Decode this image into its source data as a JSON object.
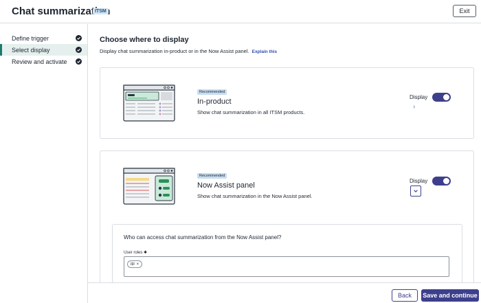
{
  "header": {
    "title": "Chat summarization",
    "badge": "ITSM",
    "exit_label": "Exit"
  },
  "sidebar": {
    "steps": [
      {
        "label": "Define trigger",
        "completed": true,
        "active": false
      },
      {
        "label": "Select display",
        "completed": true,
        "active": true
      },
      {
        "label": "Review and activate",
        "completed": true,
        "active": false
      }
    ]
  },
  "main": {
    "title": "Choose where to display",
    "subtitle": "Display chat summarization in-product or in the Now Assist panel.",
    "explain_link": "Explain this",
    "options": [
      {
        "badge": "Recommended",
        "title": "In-product",
        "description": "Show chat summarization in all ITSM products.",
        "toggle_label": "Display",
        "toggle_on": true,
        "expand_icon": "chevron-right-icon"
      },
      {
        "badge": "Recommended",
        "title": "Now Assist panel",
        "description": "Show chat summarization in the Now Assist panel.",
        "toggle_label": "Display",
        "toggle_on": true,
        "expand_icon": "chevron-down-icon"
      }
    ],
    "access": {
      "question": "Who can access chat summarization from the Now Assist panel?",
      "roles_label": "User roles",
      "required_mark": "✱",
      "roles": [
        {
          "label": "itil",
          "remove_icon": "close-icon"
        }
      ]
    }
  },
  "footer": {
    "back_label": "Back",
    "save_label": "Save and continue"
  },
  "colors": {
    "accent": "#3d3f8c",
    "active_step_bg": "#e5f0ee",
    "badge_bg": "#c7dcef"
  }
}
